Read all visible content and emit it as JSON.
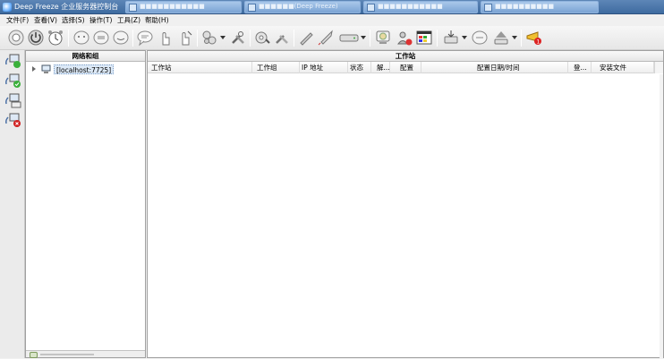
{
  "window": {
    "title": "Deep Freeze 企业服务器控制台"
  },
  "taskbar": [
    {
      "label": "■■■■■■■■■■■"
    },
    {
      "label": "■■■■■■(Deep Freeze)"
    },
    {
      "label": "■■■■■■■■■■■"
    },
    {
      "label": "■■■■■■■■■■"
    }
  ],
  "menu": [
    {
      "label": "文件(F)"
    },
    {
      "label": "查看(V)"
    },
    {
      "label": "选择(S)"
    },
    {
      "label": "操作(T)"
    },
    {
      "label": "工具(Z)"
    },
    {
      "label": "帮助(H)"
    }
  ],
  "tree_panel": {
    "title": "网络和组",
    "node": "[localhost:7725]"
  },
  "ws_panel": {
    "title": "工作站",
    "columns": [
      "工作站",
      "工作组",
      "IP 地址",
      "状态",
      "解...",
      "配置",
      "配置日期/时间",
      "登...",
      "安装文件"
    ]
  },
  "colors": {
    "titlebar": "#3e6ba0",
    "selection": "#dce9f7"
  }
}
